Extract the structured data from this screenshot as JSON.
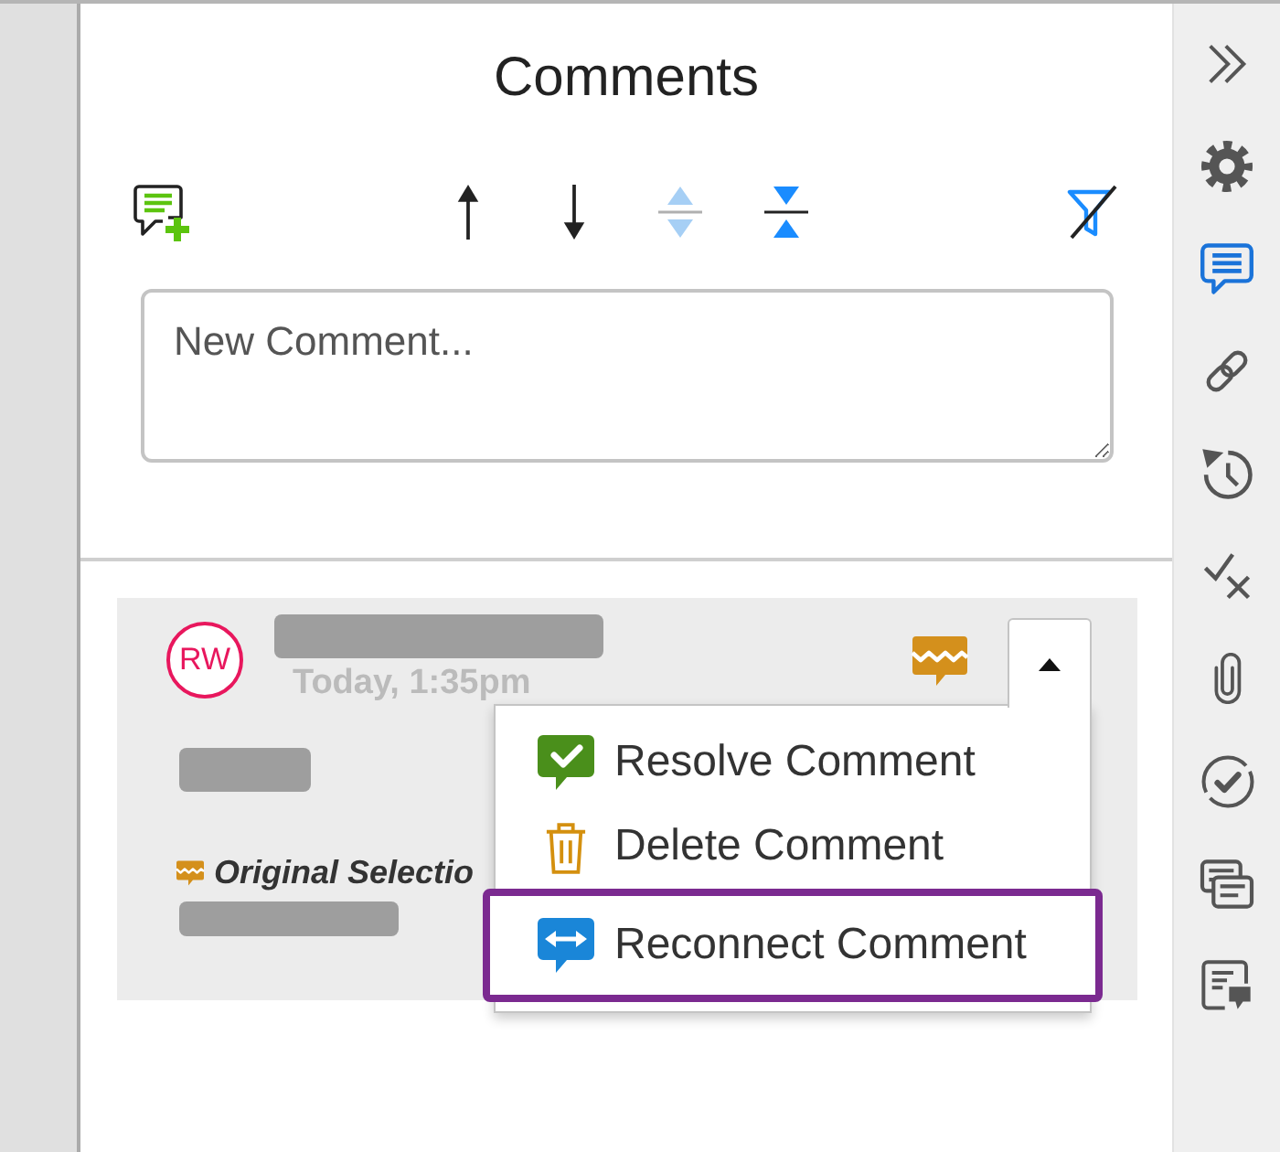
{
  "panel": {
    "title": "Comments"
  },
  "toolbar": [
    {
      "disabled": false
    },
    {
      "disabled": false
    },
    {
      "disabled": false
    },
    {
      "disabled": true
    },
    {
      "disabled": false
    },
    {
      "disabled": false
    }
  ],
  "new_comment": {
    "placeholder": "New Comment..."
  },
  "comments": [
    {
      "initials": "RW",
      "time": "Today, 1:35pm",
      "detached": true,
      "selection_label": "Original Selectio",
      "menu_open": true,
      "menu": [
        {
          "label": "Resolve Comment",
          "highlighted": false
        },
        {
          "label": "Delete Comment",
          "highlighted": false
        },
        {
          "label": "Reconnect Comment",
          "highlighted": true
        }
      ]
    }
  ],
  "sidebar": {
    "items": [
      {
        "selected": false
      },
      {
        "selected": false
      },
      {
        "selected": true
      },
      {
        "selected": false
      },
      {
        "selected": false
      },
      {
        "selected": false
      },
      {
        "selected": false
      },
      {
        "selected": false
      },
      {
        "selected": false
      },
      {
        "selected": false
      }
    ]
  }
}
